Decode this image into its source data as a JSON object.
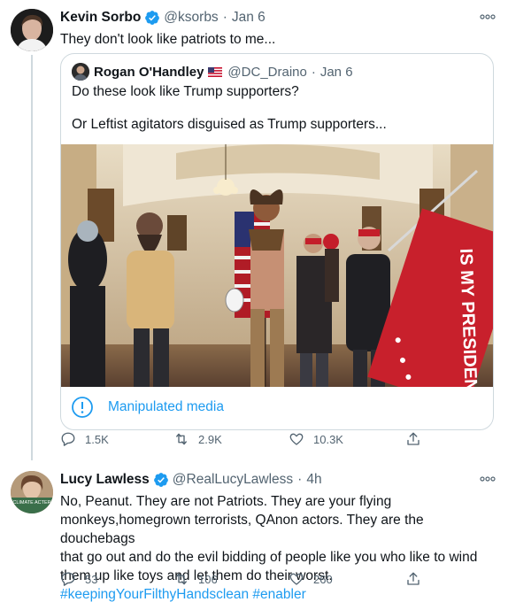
{
  "tweet_main": {
    "name": "Kevin Sorbo",
    "handle": "@ksorbs",
    "time": "Jan 6",
    "text": "They don't look like patriots to me...",
    "quote": {
      "name": "Rogan O'Handley",
      "handle": "@DC_Draino",
      "time": "Jan 6",
      "line1": "Do these look like Trump supporters?",
      "line2": "Or Leftist agitators disguised as Trump supporters...",
      "notice": "Manipulated media",
      "flag_text": "IS MY PRESIDENT"
    },
    "stats": {
      "replies": "1.5K",
      "retweets": "2.9K",
      "likes": "10.3K"
    }
  },
  "tweet_reply": {
    "name": "Lucy Lawless",
    "handle": "@RealLucyLawless",
    "time": "4h",
    "avatar_badge": "CLIMATE ACTER",
    "lines": [
      "No, Peanut. They are not Patriots. They are your flying",
      "monkeys,homegrown terrorists, QAnon actors. They are the douchebags",
      "that go out and do the evil bidding of people like you who like to wind",
      "them up like toys and let them do their worst."
    ],
    "hashtags": "#keepingYourFilthyHandsclean #enabler",
    "stats": {
      "replies": "53",
      "retweets": "106",
      "likes": "260"
    }
  },
  "colors": {
    "accent": "#1d9bf0",
    "text": "#0f1419",
    "muted": "#536471",
    "border": "#cfd9de"
  },
  "icons": [
    "more-icon",
    "verified-icon",
    "us-flag-icon",
    "info-icon",
    "reply-icon",
    "retweet-icon",
    "like-icon",
    "share-icon"
  ]
}
